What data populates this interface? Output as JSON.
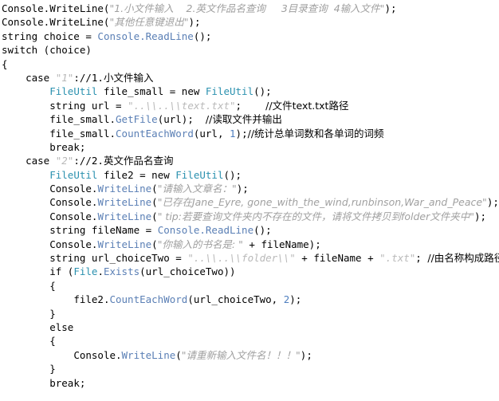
{
  "editor": {
    "language": "csharp",
    "background": "#ffffff",
    "colors": {
      "plain": "#000000",
      "type": "#2b91af",
      "string_ascii": "#b9b9b9",
      "string_cjk": "#a0a0a0",
      "comment": "#000000",
      "number": "#4f7fbf",
      "method": "#5a7fb5"
    }
  },
  "code": {
    "lines": [
      {
        "n": 1,
        "indent": 0,
        "tokens": [
          {
            "c": "plain",
            "t": "Console.WriteLine("
          },
          {
            "c": "string_cjk",
            "t": "\"1.小文件输入    2.英文作品名查询     3目录查询  4输入文件\""
          },
          {
            "c": "plain",
            "t": ");"
          }
        ]
      },
      {
        "n": 2,
        "indent": 0,
        "tokens": [
          {
            "c": "plain",
            "t": "Console.WriteLine("
          },
          {
            "c": "string_cjk",
            "t": "\"其他任意键退出\""
          },
          {
            "c": "plain",
            "t": ");"
          }
        ]
      },
      {
        "n": 3,
        "indent": 0,
        "tokens": [
          {
            "c": "plain",
            "t": "string choice = "
          },
          {
            "c": "method",
            "t": "Console.ReadLine"
          },
          {
            "c": "plain",
            "t": "();"
          }
        ]
      },
      {
        "n": 4,
        "indent": 0,
        "tokens": [
          {
            "c": "plain",
            "t": "switch (choice)"
          }
        ]
      },
      {
        "n": 5,
        "indent": 0,
        "tokens": [
          {
            "c": "plain",
            "t": "{"
          }
        ]
      },
      {
        "n": 6,
        "indent": 1,
        "tokens": [
          {
            "c": "plain",
            "t": "case "
          },
          {
            "c": "string_ascii",
            "t": "\"1\""
          },
          {
            "c": "plain",
            "t": "://1."
          },
          {
            "c": "comment",
            "t": "小文件输入"
          }
        ]
      },
      {
        "n": 7,
        "indent": 2,
        "tokens": [
          {
            "c": "type",
            "t": "FileUtil"
          },
          {
            "c": "plain",
            "t": " file_small = new "
          },
          {
            "c": "type",
            "t": "FileUtil"
          },
          {
            "c": "plain",
            "t": "();"
          }
        ]
      },
      {
        "n": 8,
        "indent": 2,
        "tokens": [
          {
            "c": "plain",
            "t": "string url = "
          },
          {
            "c": "string_ascii",
            "t": "\"..\\\\..\\\\text.txt\""
          },
          {
            "c": "plain",
            "t": ";    "
          },
          {
            "c": "comment",
            "t": "//文件text.txt路径"
          }
        ]
      },
      {
        "n": 9,
        "indent": 2,
        "tokens": [
          {
            "c": "plain",
            "t": "file_small."
          },
          {
            "c": "method",
            "t": "GetFile"
          },
          {
            "c": "plain",
            "t": "(url);  "
          },
          {
            "c": "comment",
            "t": "//读取文件并输出"
          }
        ]
      },
      {
        "n": 10,
        "indent": 2,
        "tokens": [
          {
            "c": "plain",
            "t": "file_small."
          },
          {
            "c": "method",
            "t": "CountEachWord"
          },
          {
            "c": "plain",
            "t": "(url, "
          },
          {
            "c": "number",
            "t": "1"
          },
          {
            "c": "plain",
            "t": ");"
          },
          {
            "c": "comment",
            "t": "//统计总单词数和各单词的词频"
          }
        ]
      },
      {
        "n": 11,
        "indent": 2,
        "tokens": [
          {
            "c": "plain",
            "t": "break;"
          }
        ]
      },
      {
        "n": 12,
        "indent": 1,
        "tokens": [
          {
            "c": "plain",
            "t": "case "
          },
          {
            "c": "string_ascii",
            "t": "\"2\""
          },
          {
            "c": "plain",
            "t": "://2."
          },
          {
            "c": "comment",
            "t": "英文作品名查询"
          }
        ]
      },
      {
        "n": 13,
        "indent": 2,
        "tokens": [
          {
            "c": "type",
            "t": "FileUtil"
          },
          {
            "c": "plain",
            "t": " file2 = new "
          },
          {
            "c": "type",
            "t": "FileUtil"
          },
          {
            "c": "plain",
            "t": "();"
          }
        ]
      },
      {
        "n": 14,
        "indent": 2,
        "tokens": [
          {
            "c": "plain",
            "t": "Console."
          },
          {
            "c": "method",
            "t": "WriteLine"
          },
          {
            "c": "plain",
            "t": "("
          },
          {
            "c": "string_cjk",
            "t": "\"请输入文章名：\""
          },
          {
            "c": "plain",
            "t": ");"
          }
        ]
      },
      {
        "n": 15,
        "indent": 2,
        "tokens": [
          {
            "c": "plain",
            "t": "Console."
          },
          {
            "c": "method",
            "t": "WriteLine"
          },
          {
            "c": "plain",
            "t": "("
          },
          {
            "c": "string_cjk",
            "t": "\"已存在Jane_Eyre, gone_with_the_wind,runbinson,War_and_Peace\""
          },
          {
            "c": "plain",
            "t": ");"
          }
        ]
      },
      {
        "n": 16,
        "indent": 2,
        "tokens": [
          {
            "c": "plain",
            "t": "Console."
          },
          {
            "c": "method",
            "t": "WriteLine"
          },
          {
            "c": "plain",
            "t": "("
          },
          {
            "c": "string_cjk",
            "t": "\" tip:若要查询文件夹内不存在的文件，请将文件拷贝到folder文件夹中\""
          },
          {
            "c": "plain",
            "t": ");"
          }
        ]
      },
      {
        "n": 17,
        "indent": 2,
        "tokens": [
          {
            "c": "plain",
            "t": "string fileName = "
          },
          {
            "c": "method",
            "t": "Console.ReadLine"
          },
          {
            "c": "plain",
            "t": "();"
          }
        ]
      },
      {
        "n": 18,
        "indent": 2,
        "tokens": [
          {
            "c": "plain",
            "t": "Console."
          },
          {
            "c": "method",
            "t": "WriteLine"
          },
          {
            "c": "plain",
            "t": "("
          },
          {
            "c": "string_cjk",
            "t": "\"你输入的书名是: \""
          },
          {
            "c": "plain",
            "t": " + fileName);"
          }
        ]
      },
      {
        "n": 19,
        "indent": 2,
        "tokens": [
          {
            "c": "plain",
            "t": "string url_choiceTwo = "
          },
          {
            "c": "string_ascii",
            "t": "\"..\\\\..\\\\folder\\\\\""
          },
          {
            "c": "plain",
            "t": " + fileName + "
          },
          {
            "c": "string_ascii",
            "t": "\".txt\""
          },
          {
            "c": "plain",
            "t": "; "
          },
          {
            "c": "comment",
            "t": "//由名称构成路径"
          }
        ]
      },
      {
        "n": 20,
        "indent": 2,
        "tokens": [
          {
            "c": "plain",
            "t": "if ("
          },
          {
            "c": "type",
            "t": "File"
          },
          {
            "c": "plain",
            "t": "."
          },
          {
            "c": "method",
            "t": "Exists"
          },
          {
            "c": "plain",
            "t": "(url_choiceTwo))"
          }
        ]
      },
      {
        "n": 21,
        "indent": 2,
        "tokens": [
          {
            "c": "plain",
            "t": "{"
          }
        ]
      },
      {
        "n": 22,
        "indent": 3,
        "tokens": [
          {
            "c": "plain",
            "t": "file2."
          },
          {
            "c": "method",
            "t": "CountEachWord"
          },
          {
            "c": "plain",
            "t": "(url_choiceTwo, "
          },
          {
            "c": "number",
            "t": "2"
          },
          {
            "c": "plain",
            "t": ");"
          }
        ]
      },
      {
        "n": 23,
        "indent": 2,
        "tokens": [
          {
            "c": "plain",
            "t": "}"
          }
        ]
      },
      {
        "n": 24,
        "indent": 2,
        "tokens": [
          {
            "c": "plain",
            "t": "else"
          }
        ]
      },
      {
        "n": 25,
        "indent": 2,
        "tokens": [
          {
            "c": "plain",
            "t": "{"
          }
        ]
      },
      {
        "n": 26,
        "indent": 3,
        "tokens": [
          {
            "c": "plain",
            "t": "Console."
          },
          {
            "c": "method",
            "t": "WriteLine"
          },
          {
            "c": "plain",
            "t": "("
          },
          {
            "c": "string_cjk",
            "t": "\"请重新输入文件名！！！\""
          },
          {
            "c": "plain",
            "t": ");"
          }
        ]
      },
      {
        "n": 27,
        "indent": 2,
        "tokens": [
          {
            "c": "plain",
            "t": "}"
          }
        ]
      },
      {
        "n": 28,
        "indent": 2,
        "tokens": [
          {
            "c": "plain",
            "t": "break;"
          }
        ]
      }
    ]
  }
}
